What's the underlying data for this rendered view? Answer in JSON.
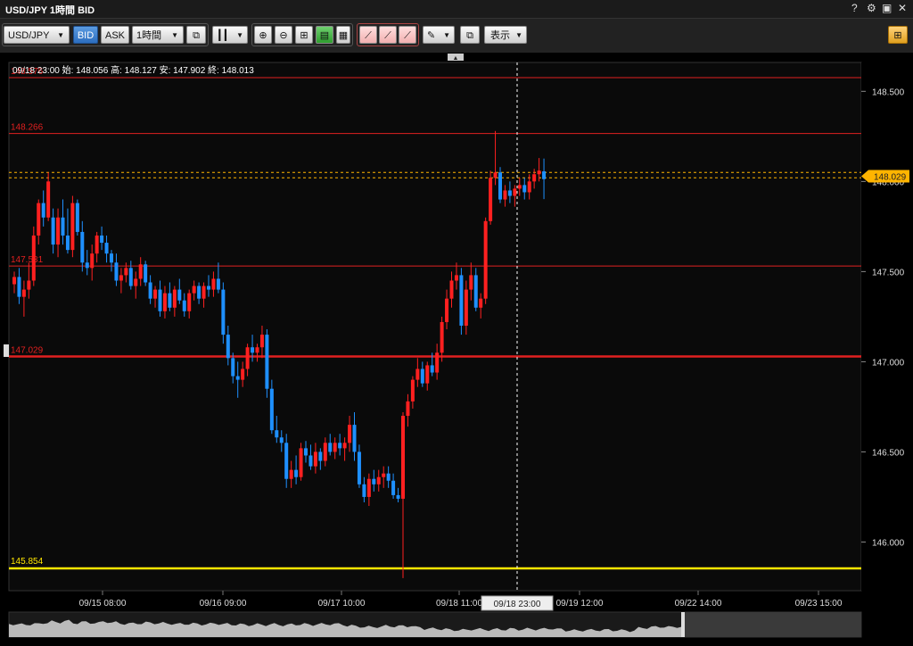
{
  "window": {
    "title": "USD/JPY 1時間 BID",
    "controls": [
      "?",
      "⚙",
      "▣",
      "✕"
    ]
  },
  "toolbar": {
    "symbol": "USD/JPY",
    "bid_label": "BID",
    "ask_label": "ASK",
    "timeframe": "1時間",
    "display_label": "表示"
  },
  "colors": {
    "up": "#ff2020",
    "down": "#1e90ff",
    "hline": "#e02020",
    "support": "#ffe600",
    "crosshair": "#ffffff",
    "current": "#ffb400"
  },
  "chart_data": {
    "type": "candlestick",
    "symbol": "USD/JPY",
    "timeframe": "1時間",
    "side": "BID",
    "info": "09/18 23:00  始: 148.056  高: 148.127  安: 147.902  終: 148.013",
    "ylim": [
      145.73,
      148.66
    ],
    "yticks": [
      {
        "value": 148.5,
        "label": "148.500"
      },
      {
        "value": 148.0,
        "label": "148.000"
      },
      {
        "value": 147.5,
        "label": "147.500"
      },
      {
        "value": 147.0,
        "label": "147.000"
      },
      {
        "value": 146.5,
        "label": "146.500"
      },
      {
        "value": 146.0,
        "label": "146.000"
      }
    ],
    "xticks": [
      "09/15 08:00",
      "09/16 09:00",
      "09/17 10:00",
      "09/18 11:00",
      "09/19 12:00",
      "09/22 14:00",
      "09/23 15:00"
    ],
    "crosshair_label": "09/18 23:00",
    "current_price": "148.029",
    "current_value": 148.029,
    "hlines": [
      {
        "value": 148.576,
        "label": "148.576",
        "width": 1
      },
      {
        "value": 148.266,
        "label": "148.266",
        "width": 1
      },
      {
        "value": 147.531,
        "label": "147.531",
        "width": 1
      },
      {
        "value": 147.029,
        "label": "147.029",
        "width": 2.5
      }
    ],
    "support_line": {
      "value": 145.854,
      "label": "145.854"
    },
    "dashed_lines": [
      148.05,
      148.02
    ],
    "candles": [
      [
        147.43,
        147.5,
        147.38,
        147.47
      ],
      [
        147.47,
        147.52,
        147.32,
        147.36
      ],
      [
        147.36,
        147.45,
        147.25,
        147.4
      ],
      [
        147.4,
        147.55,
        147.35,
        147.45
      ],
      [
        147.45,
        147.75,
        147.42,
        147.7
      ],
      [
        147.7,
        147.9,
        147.65,
        147.88
      ],
      [
        147.88,
        147.95,
        147.75,
        147.8
      ],
      [
        147.8,
        148.05,
        147.78,
        148.0
      ],
      [
        147.8,
        147.85,
        147.6,
        147.65
      ],
      [
        147.65,
        147.85,
        147.58,
        147.8
      ],
      [
        147.8,
        147.9,
        147.65,
        147.7
      ],
      [
        147.7,
        147.85,
        147.6,
        147.62
      ],
      [
        147.62,
        147.92,
        147.58,
        147.88
      ],
      [
        147.88,
        147.9,
        147.7,
        147.72
      ],
      [
        147.72,
        147.78,
        147.5,
        147.55
      ],
      [
        147.55,
        147.62,
        147.48,
        147.52
      ],
      [
        147.52,
        147.65,
        147.45,
        147.6
      ],
      [
        147.6,
        147.72,
        147.55,
        147.7
      ],
      [
        147.7,
        147.75,
        147.62,
        147.66
      ],
      [
        147.66,
        147.7,
        147.55,
        147.6
      ],
      [
        147.6,
        147.62,
        147.5,
        147.55
      ],
      [
        147.55,
        147.6,
        147.42,
        147.45
      ],
      [
        147.45,
        147.52,
        147.38,
        147.48
      ],
      [
        147.48,
        147.55,
        147.44,
        147.52
      ],
      [
        147.52,
        147.56,
        147.4,
        147.42
      ],
      [
        147.42,
        147.5,
        147.35,
        147.46
      ],
      [
        147.46,
        147.58,
        147.42,
        147.54
      ],
      [
        147.54,
        147.56,
        147.42,
        147.44
      ],
      [
        147.44,
        147.48,
        147.32,
        147.35
      ],
      [
        147.35,
        147.42,
        147.3,
        147.4
      ],
      [
        147.4,
        147.45,
        147.25,
        147.28
      ],
      [
        147.28,
        147.42,
        147.24,
        147.38
      ],
      [
        147.38,
        147.44,
        147.28,
        147.3
      ],
      [
        147.3,
        147.42,
        147.25,
        147.4
      ],
      [
        147.4,
        147.46,
        147.32,
        147.34
      ],
      [
        147.34,
        147.38,
        147.25,
        147.28
      ],
      [
        147.28,
        147.4,
        147.24,
        147.38
      ],
      [
        147.38,
        147.45,
        147.34,
        147.42
      ],
      [
        147.42,
        147.44,
        147.32,
        147.35
      ],
      [
        147.35,
        147.44,
        147.3,
        147.42
      ],
      [
        147.42,
        147.48,
        147.36,
        147.4
      ],
      [
        147.4,
        147.5,
        147.36,
        147.46
      ],
      [
        147.46,
        147.55,
        147.38,
        147.4
      ],
      [
        147.4,
        147.44,
        147.1,
        147.15
      ],
      [
        147.15,
        147.2,
        146.98,
        147.02
      ],
      [
        147.02,
        147.05,
        146.88,
        146.92
      ],
      [
        146.92,
        147.0,
        146.8,
        146.9
      ],
      [
        146.9,
        147.0,
        146.86,
        146.96
      ],
      [
        146.96,
        147.1,
        146.92,
        147.08
      ],
      [
        147.08,
        147.15,
        147.0,
        147.05
      ],
      [
        147.05,
        147.1,
        147.0,
        147.08
      ],
      [
        147.08,
        147.2,
        147.02,
        147.15
      ],
      [
        147.15,
        147.18,
        146.8,
        146.85
      ],
      [
        146.85,
        146.9,
        146.6,
        146.62
      ],
      [
        146.62,
        146.7,
        146.55,
        146.58
      ],
      [
        146.58,
        146.62,
        146.5,
        146.55
      ],
      [
        146.55,
        146.6,
        146.3,
        146.35
      ],
      [
        146.35,
        146.45,
        146.3,
        146.4
      ],
      [
        146.4,
        146.48,
        146.32,
        146.36
      ],
      [
        146.36,
        146.55,
        146.34,
        146.52
      ],
      [
        146.52,
        146.56,
        146.44,
        146.48
      ],
      [
        146.48,
        146.54,
        146.4,
        146.42
      ],
      [
        146.42,
        146.55,
        146.38,
        146.5
      ],
      [
        146.5,
        146.52,
        146.4,
        146.45
      ],
      [
        146.45,
        146.58,
        146.42,
        146.55
      ],
      [
        146.55,
        146.6,
        146.48,
        146.5
      ],
      [
        146.5,
        146.58,
        146.46,
        146.55
      ],
      [
        146.55,
        146.6,
        146.48,
        146.52
      ],
      [
        146.52,
        146.58,
        146.45,
        146.55
      ],
      [
        146.55,
        146.7,
        146.5,
        146.65
      ],
      [
        146.65,
        146.72,
        146.45,
        146.5
      ],
      [
        146.5,
        146.54,
        146.3,
        146.32
      ],
      [
        146.32,
        146.36,
        146.22,
        146.25
      ],
      [
        146.25,
        146.38,
        146.2,
        146.35
      ],
      [
        146.35,
        146.4,
        146.28,
        146.32
      ],
      [
        146.32,
        146.4,
        146.28,
        146.36
      ],
      [
        146.36,
        146.42,
        146.3,
        146.38
      ],
      [
        146.38,
        146.42,
        146.3,
        146.34
      ],
      [
        146.34,
        146.38,
        146.24,
        146.26
      ],
      [
        146.26,
        146.3,
        146.22,
        146.24
      ],
      [
        146.24,
        146.72,
        145.8,
        146.7
      ],
      [
        146.7,
        146.82,
        146.64,
        146.78
      ],
      [
        146.78,
        146.92,
        146.74,
        146.9
      ],
      [
        146.9,
        147.02,
        146.86,
        146.96
      ],
      [
        146.96,
        147.0,
        146.86,
        146.88
      ],
      [
        146.88,
        147.0,
        146.84,
        146.98
      ],
      [
        146.98,
        147.05,
        146.92,
        146.94
      ],
      [
        146.94,
        147.1,
        146.9,
        147.05
      ],
      [
        147.05,
        147.25,
        147.0,
        147.22
      ],
      [
        147.22,
        147.4,
        147.18,
        147.35
      ],
      [
        147.35,
        147.5,
        147.3,
        147.45
      ],
      [
        147.45,
        147.55,
        147.4,
        147.48
      ],
      [
        147.48,
        147.52,
        147.15,
        147.2
      ],
      [
        147.2,
        147.45,
        147.15,
        147.4
      ],
      [
        147.4,
        147.55,
        147.34,
        147.48
      ],
      [
        147.48,
        147.52,
        147.28,
        147.3
      ],
      [
        147.3,
        147.38,
        147.24,
        147.35
      ],
      [
        147.35,
        147.8,
        147.32,
        147.78
      ],
      [
        147.78,
        148.06,
        147.76,
        148.02
      ],
      [
        148.02,
        148.28,
        147.98,
        148.05
      ],
      [
        148.05,
        148.08,
        147.88,
        147.9
      ],
      [
        147.9,
        147.98,
        147.86,
        147.95
      ],
      [
        147.95,
        148.0,
        147.88,
        147.92
      ],
      [
        147.92,
        147.98,
        147.86,
        147.96
      ],
      [
        147.96,
        148.02,
        147.92,
        147.98
      ],
      [
        147.98,
        148.02,
        147.9,
        147.94
      ],
      [
        147.94,
        148.04,
        147.9,
        148.0
      ],
      [
        148.0,
        148.07,
        147.96,
        148.04
      ],
      [
        148.04,
        148.13,
        148.0,
        148.06
      ],
      [
        148.056,
        148.127,
        147.902,
        148.013
      ]
    ]
  }
}
